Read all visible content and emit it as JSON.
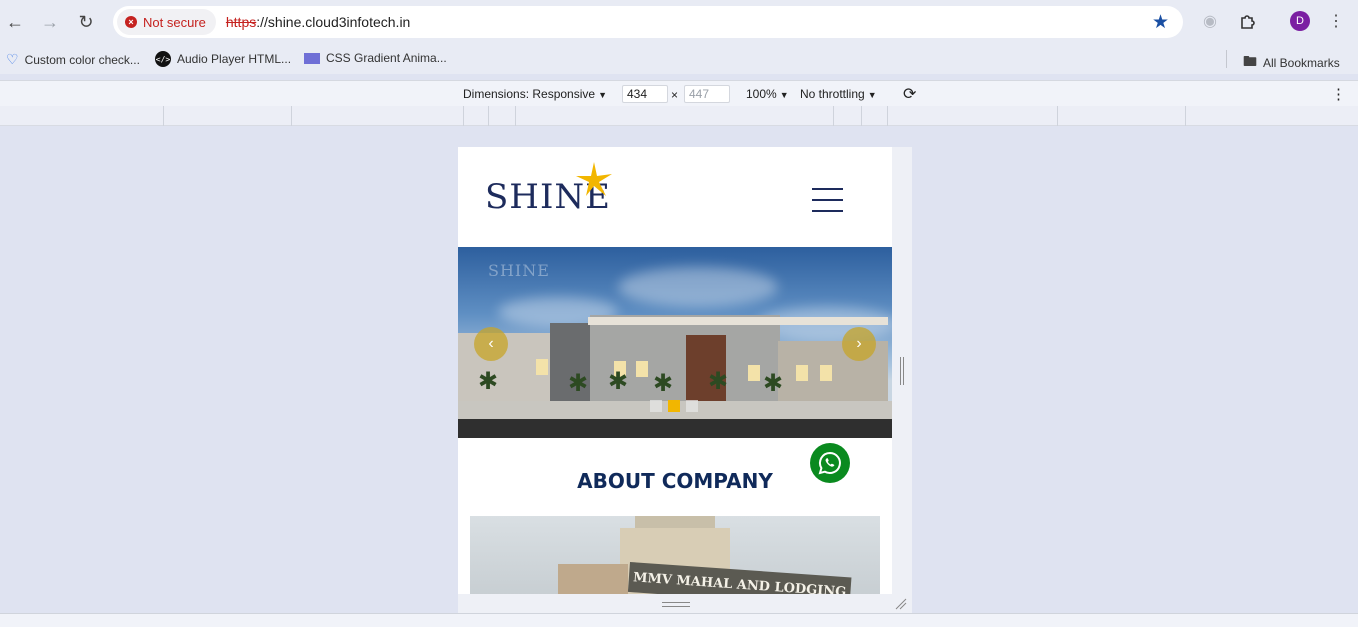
{
  "browser": {
    "security_label": "Not secure",
    "url_scheme": "https",
    "url_rest": "://shine.cloud3infotech.in",
    "profile_initial": "D",
    "bookmarks": [
      {
        "label": "Custom color check..."
      },
      {
        "label": "Audio Player HTML..."
      },
      {
        "label": "CSS Gradient Anima..."
      }
    ],
    "all_bookmarks": "All Bookmarks"
  },
  "device_toolbar": {
    "dimensions_label": "Dimensions: Responsive",
    "width": "434",
    "times": "×",
    "height": "447",
    "zoom": "100%",
    "throttling": "No throttling"
  },
  "site": {
    "logo_text": "SHINE",
    "hero_watermark": "SHINE",
    "slider_dots": 3,
    "active_dot": 2,
    "about_title": "ABOUT COMPANY",
    "about_image_sign": "MMV MAHAL AND LODGING"
  },
  "colors": {
    "brand_navy": "#1d2b5c",
    "heading_navy": "#102a5a",
    "accent_gold": "#f2b600",
    "whatsapp_green": "#0a8a1f",
    "insecure_red": "#c5221f"
  },
  "icons": {
    "back": "arrow-left-icon",
    "forward": "arrow-right-icon",
    "reload": "reload-icon",
    "bookmark_star": "star-icon",
    "extensions": "puzzle-icon",
    "menu": "kebab-icon",
    "rotate": "rotate-icon",
    "whatsapp": "whatsapp-icon"
  }
}
